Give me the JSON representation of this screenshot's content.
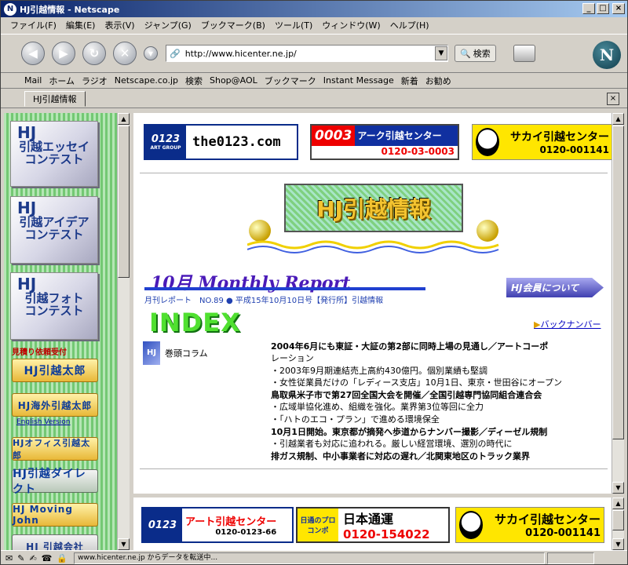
{
  "window": {
    "title": "HJ引越情報 - Netscape",
    "minimize": "_",
    "maximize": "□",
    "close": "×"
  },
  "menu": [
    "ファイル(F)",
    "編集(E)",
    "表示(V)",
    "ジャンプ(G)",
    "ブックマーク(B)",
    "ツール(T)",
    "ウィンドウ(W)",
    "ヘルプ(H)"
  ],
  "nav": {
    "url": "http://www.hicenter.ne.jp/",
    "search_label": "検索",
    "logo": "N"
  },
  "personal_bar": [
    "Mail",
    "ホーム",
    "ラジオ",
    "Netscape.co.jp",
    "検索",
    "Shop@AOL",
    "ブックマーク",
    "Instant Message",
    "新着",
    "お勧め"
  ],
  "tab": {
    "label": "HJ引越情報",
    "close": "×"
  },
  "sidebar": {
    "essay": {
      "hj": "HJ",
      "label": "引越エッセイ\nコンテスト"
    },
    "idea": {
      "hj": "HJ",
      "label": "引越アイデア\nコンテスト"
    },
    "photo": {
      "hj": "HJ",
      "label": "引越フォト\nコンテスト"
    },
    "quote_heading": "見積り依頼受付",
    "taro": "HJ引越太郎",
    "kaigai": "HJ海外引越太郎",
    "english": "English Version",
    "office": "HJオフィス引越太郎",
    "direct": "HJ引越ダイレクト",
    "moving_john": "HJ Moving John",
    "company": "HJ 引越会社"
  },
  "main": {
    "banner_0123_logo": "0123",
    "banner_0123_sub": "ART GROUP",
    "banner_0123_text": "the0123.com",
    "banner_arc_num": "0003",
    "banner_arc_name": "アーク引越センター",
    "banner_arc_tel": "0120-03-0003",
    "banner_sakai_name": "サカイ引越センター",
    "banner_sakai_tel": "0120-001141",
    "logo": "HJ引越情報",
    "report_title": "10月 Monthly Report",
    "report_sub": "月刊レポート　NO.89 ● 平成15年10月10日号【発行所】引越情報",
    "member_btn": "HJ会員について",
    "index": "INDEX",
    "back_number": "バックナンバー",
    "column_label": "巻頭コラム",
    "index_lines": [
      {
        "text": "2004年6月にも東証・大証の第2部に同時上場の見通し／アートコーポ",
        "bold": true
      },
      {
        "text": "レーション",
        "bold": false
      },
      {
        "text": "・2003年9月期連結売上高約430億円。個別業績も堅調",
        "bold": false
      },
      {
        "text": "・女性従業員だけの「レディース支店」10月1日、東京・世田谷にオープン",
        "bold": false
      },
      {
        "text": "鳥取県米子市で第27回全国大会を開催／全国引越専門協同組合連合会",
        "bold": true
      },
      {
        "text": "・広域単協化進め、組織を強化。業界第3位等回に全力",
        "bold": false
      },
      {
        "text": "・「ハトのエコ・プラン」で進める環境保全",
        "bold": false
      },
      {
        "text": "10月1日開始。東京都が摘発へ歩道からナンバー撮影／ディーゼル規制",
        "bold": true
      },
      {
        "text": "・引越業者も対応に追われる。厳しい経営環境、選別の時代に",
        "bold": false
      },
      {
        "text": "排ガス規制、中小事業者に対応の遅れ／北関東地区のトラック業界",
        "bold": true
      }
    ]
  },
  "bottom": {
    "art_logo": "0123",
    "art_name": "アート引越センター",
    "art_tel": "0120-0123-66",
    "nittsu_badge": "日通のプロコンポ",
    "nittsu_name": "日本通運",
    "nittsu_tel": "0120-154022",
    "sakai_name": "サカイ引越センター",
    "sakai_tel": "0120-001141"
  },
  "status": {
    "text": "www.hicenter.ne.jp からデータを転送中..."
  }
}
